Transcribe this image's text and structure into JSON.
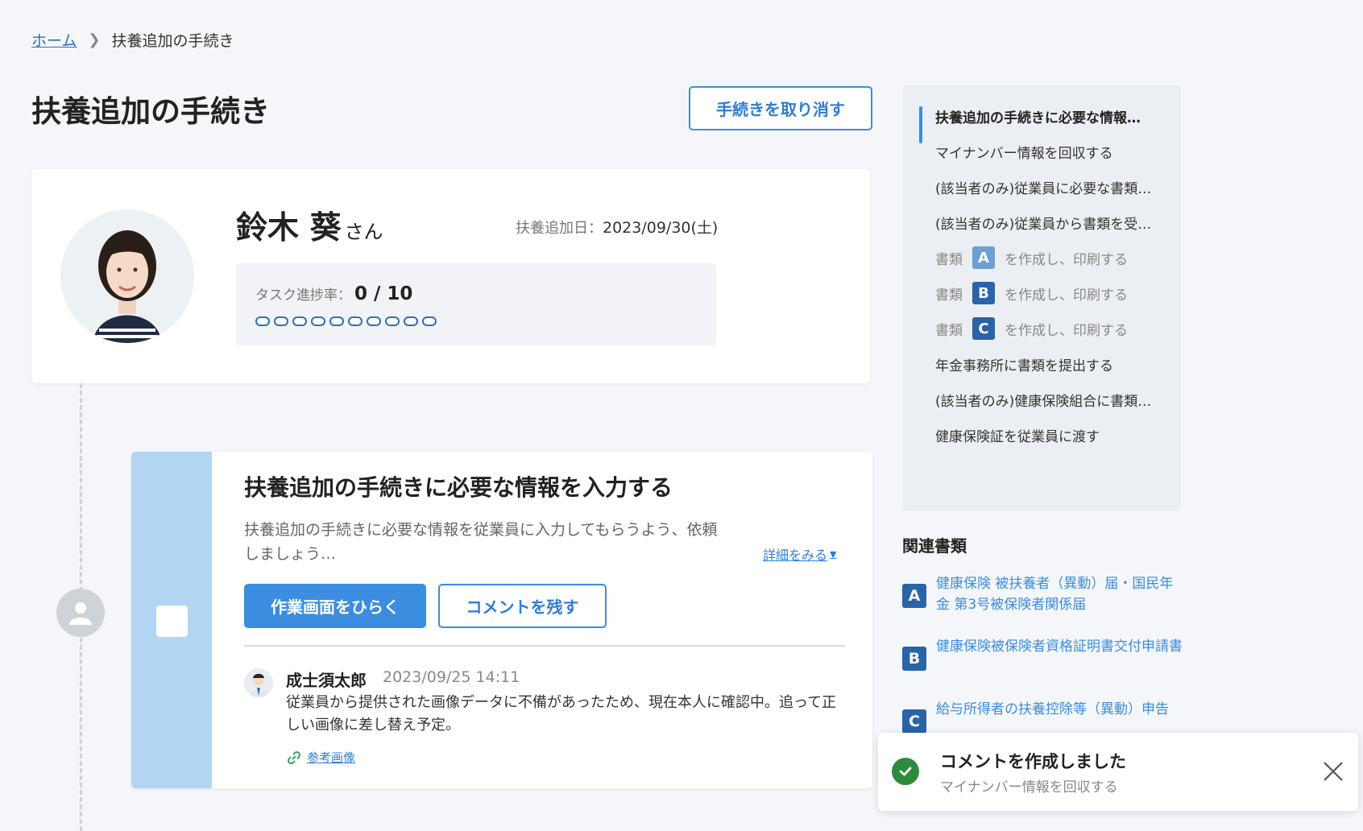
{
  "breadcrumb": {
    "home": "ホーム",
    "current": "扶養追加の手続き"
  },
  "page_title": "扶養追加の手続き",
  "cancel_button": "手続きを取り消す",
  "employee": {
    "name": "鈴木 葵",
    "suffix": "さん",
    "date_label": "扶養追加日：",
    "date_value": "2023/09/30(土)",
    "progress_label": "タスク進捗率：",
    "progress_value": "0 / 10",
    "progress_done": 0,
    "progress_total": 10
  },
  "task": {
    "title": "扶養追加の手続きに必要な情報を入力する",
    "description": "扶養追加の手続きに必要な情報を従業員に入力してもらうよう、依頼しましょう…",
    "detail_link": "詳細をみる",
    "open_button": "作業画面をひらく",
    "comment_button": "コメントを残す",
    "comment": {
      "author": "成士須太郎",
      "time": "2023/09/25 14:11",
      "body": "従業員から提供された画像データに不備があったため、現在本人に確認中。追って正しい画像に差し替え予定。",
      "link": "参考画像"
    }
  },
  "steps": [
    {
      "label": "扶養追加の手続きに必要な情報…",
      "active": true
    },
    {
      "label": "マイナンバー情報を回収する"
    },
    {
      "label": "(該当者のみ)従業員に必要な書類…"
    },
    {
      "label": "(該当者のみ)従業員から書類を受…"
    },
    {
      "prefix": "書類",
      "badge": "A",
      "suffix": "を作成し、印刷する",
      "muted": true,
      "badge_color": "#6d9fd4"
    },
    {
      "prefix": "書類",
      "badge": "B",
      "suffix": "を作成し、印刷する",
      "badge_color": "#2a63a8"
    },
    {
      "prefix": "書類",
      "badge": "C",
      "suffix": "を作成し、印刷する",
      "badge_color": "#2a63a8"
    },
    {
      "label": "年金事務所に書類を提出する"
    },
    {
      "label": "(該当者のみ)健康保険組合に書類…"
    },
    {
      "label": "健康保険証を従業員に渡す"
    }
  ],
  "related": {
    "title": "関連書類",
    "docs": [
      {
        "badge": "A",
        "text": "健康保険 被扶養者（異動）届・国民年金 第3号被保険者関係届"
      },
      {
        "badge": "B",
        "text": "健康保険被保険者資格証明書交付申請書"
      },
      {
        "badge": "C",
        "text": "給与所得者の扶養控除等（異動）申告"
      }
    ]
  },
  "toast": {
    "title": "コメントを作成しました",
    "subtitle": "マイナンバー情報を回収する"
  }
}
